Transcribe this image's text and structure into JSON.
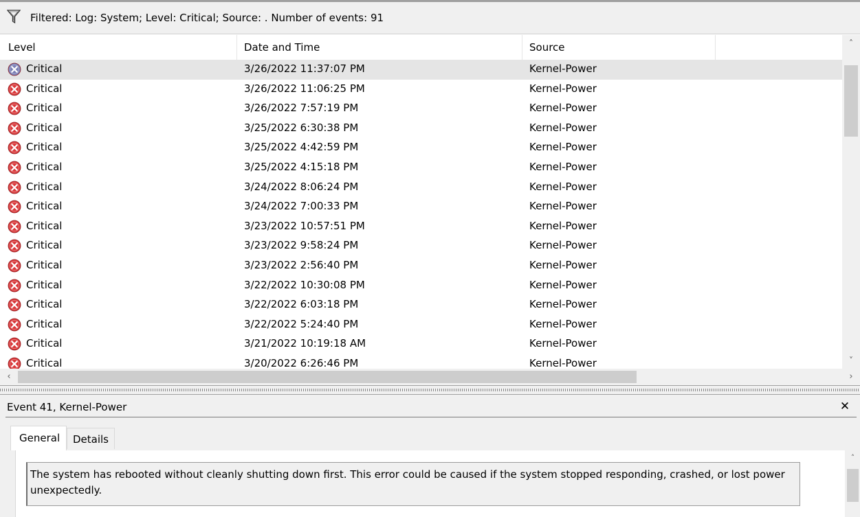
{
  "filter": {
    "icon": "filter-funnel-icon",
    "text": "Filtered: Log: System; Level: Critical; Source: . Number of events: 91"
  },
  "columns": {
    "level": "Level",
    "datetime": "Date and Time",
    "source": "Source"
  },
  "events": [
    {
      "level": "Critical",
      "datetime": "3/26/2022 11:37:07 PM",
      "source": "Kernel-Power",
      "selected": true
    },
    {
      "level": "Critical",
      "datetime": "3/26/2022 11:06:25 PM",
      "source": "Kernel-Power"
    },
    {
      "level": "Critical",
      "datetime": "3/26/2022 7:57:19 PM",
      "source": "Kernel-Power"
    },
    {
      "level": "Critical",
      "datetime": "3/25/2022 6:30:38 PM",
      "source": "Kernel-Power"
    },
    {
      "level": "Critical",
      "datetime": "3/25/2022 4:42:59 PM",
      "source": "Kernel-Power"
    },
    {
      "level": "Critical",
      "datetime": "3/25/2022 4:15:18 PM",
      "source": "Kernel-Power"
    },
    {
      "level": "Critical",
      "datetime": "3/24/2022 8:06:24 PM",
      "source": "Kernel-Power"
    },
    {
      "level": "Critical",
      "datetime": "3/24/2022 7:00:33 PM",
      "source": "Kernel-Power"
    },
    {
      "level": "Critical",
      "datetime": "3/23/2022 10:57:51 PM",
      "source": "Kernel-Power"
    },
    {
      "level": "Critical",
      "datetime": "3/23/2022 9:58:24 PM",
      "source": "Kernel-Power"
    },
    {
      "level": "Critical",
      "datetime": "3/23/2022 2:56:40 PM",
      "source": "Kernel-Power"
    },
    {
      "level": "Critical",
      "datetime": "3/22/2022 10:30:08 PM",
      "source": "Kernel-Power"
    },
    {
      "level": "Critical",
      "datetime": "3/22/2022 6:03:18 PM",
      "source": "Kernel-Power"
    },
    {
      "level": "Critical",
      "datetime": "3/22/2022 5:24:40 PM",
      "source": "Kernel-Power"
    },
    {
      "level": "Critical",
      "datetime": "3/21/2022 10:19:18 AM",
      "source": "Kernel-Power"
    },
    {
      "level": "Critical",
      "datetime": "3/20/2022 6:26:46 PM",
      "source": "Kernel-Power"
    }
  ],
  "details": {
    "title": "Event 41, Kernel-Power",
    "close_icon": "close-icon",
    "tabs": {
      "general": "General",
      "details": "Details"
    },
    "message": "The system has rebooted without cleanly shutting down first. This error could be caused if the system stopped responding, crashed, or lost power unexpectedly."
  },
  "colors": {
    "critical_icon": "#d9383a",
    "critical_icon_selected": "#7a7fb5",
    "selection": "#e5e5e5",
    "chrome": "#f0f0f0"
  }
}
